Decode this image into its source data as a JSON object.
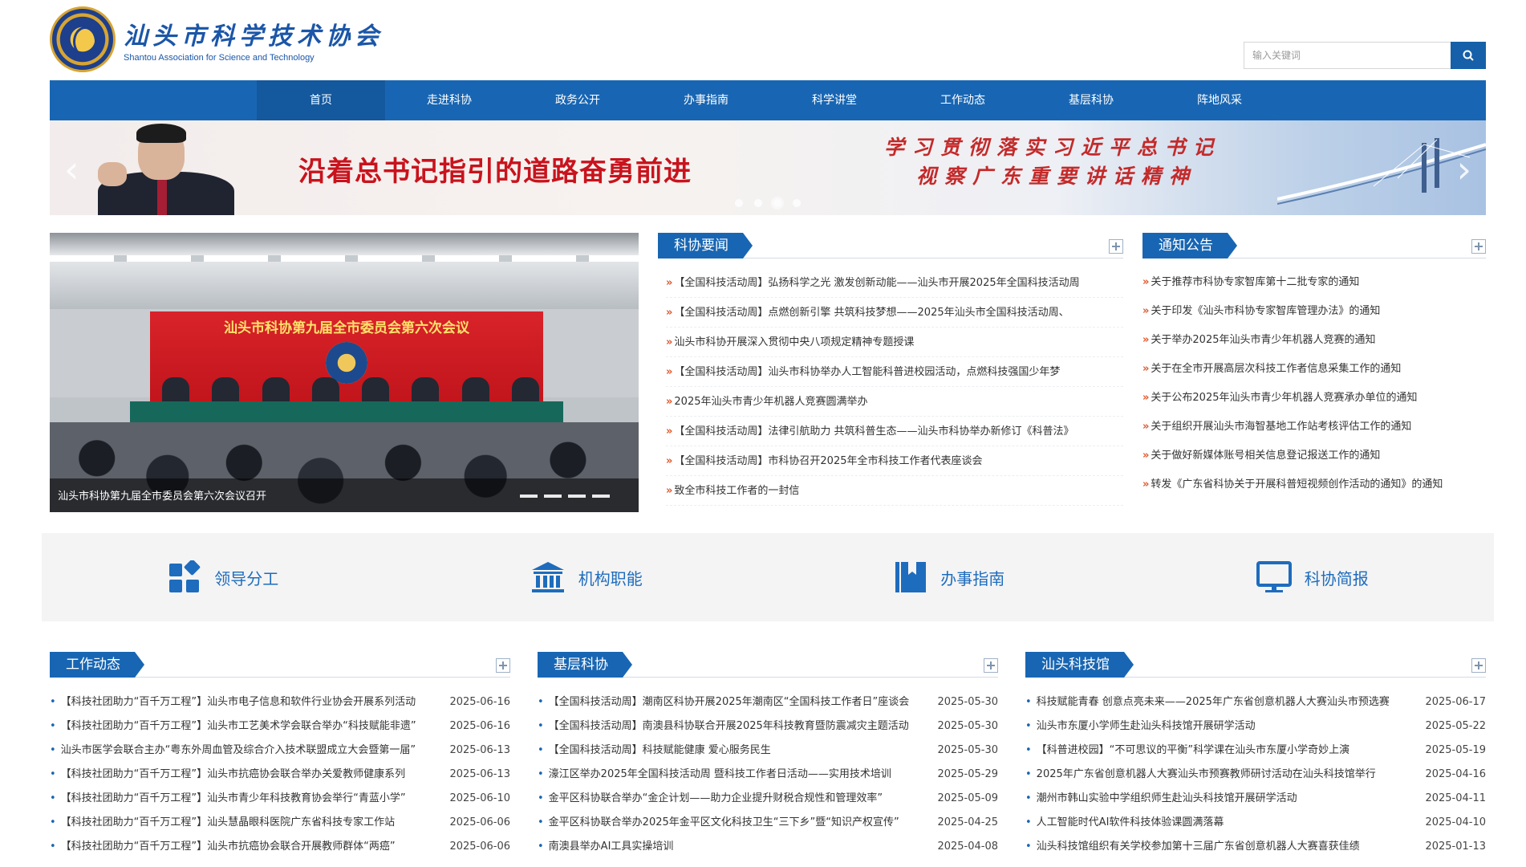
{
  "header": {
    "logo_cn": "汕头市科学技术协会",
    "logo_en": "Shantou Association for Science and Technology",
    "search_placeholder": "输入关键词"
  },
  "nav": [
    "首页",
    "走进科协",
    "政务公开",
    "办事指南",
    "科学讲堂",
    "工作动态",
    "基层科协",
    "阵地风采"
  ],
  "banner": {
    "title": "沿着总书记指引的道路奋勇前进",
    "sub_line1": "学习贯彻落实习近平总书记",
    "sub_line2": "视察广东重要讲话精神"
  },
  "photo": {
    "screen_text": "汕头市科协第九届全市委员会第六次会议",
    "caption": "汕头市科协第九届全市委员会第六次会议召开"
  },
  "news": {
    "title": "科协要闻",
    "items": [
      "【全国科技活动周】弘扬科学之光 激发创新动能——汕头市开展2025年全国科技活动周",
      "【全国科技活动周】点燃创新引擎 共筑科技梦想——2025年汕头市全国科技活动周、",
      "汕头市科协开展深入贯彻中央八项规定精神专题授课",
      "【全国科技活动周】汕头市科协举办人工智能科普进校园活动，点燃科技强国少年梦",
      "2025年汕头市青少年机器人竞赛圆满举办",
      "【全国科技活动周】法律引航助力 共筑科普生态——汕头市科协举办新修订《科普法》",
      "【全国科技活动周】市科协召开2025年全市科技工作者代表座谈会",
      "致全市科技工作者的一封信"
    ]
  },
  "notice": {
    "title": "通知公告",
    "items": [
      "关于推荐市科协专家智库第十二批专家的通知",
      "关于印发《汕头市科协专家智库管理办法》的通知",
      "关于举办2025年汕头市青少年机器人竞赛的通知",
      "关于在全市开展高层次科技工作者信息采集工作的通知",
      "关于公布2025年汕头市青少年机器人竞赛承办单位的通知",
      "关于组织开展汕头市海智基地工作站考核评估工作的通知",
      "关于做好新媒体账号相关信息登记报送工作的通知",
      "转发《广东省科协关于开展科普短视频创作活动的通知》的通知"
    ]
  },
  "quick_links": [
    {
      "label": "领导分工",
      "icon": "leadership-icon"
    },
    {
      "label": "机构职能",
      "icon": "institution-icon"
    },
    {
      "label": "办事指南",
      "icon": "guide-book-icon"
    },
    {
      "label": "科协简报",
      "icon": "monitor-icon"
    }
  ],
  "work": {
    "title": "工作动态",
    "items": [
      {
        "t": "【科技社团助力“百千万工程”】汕头市电子信息和软件行业协会开展系列活动",
        "d": "2025-06-16"
      },
      {
        "t": "【科技社团助力“百千万工程”】汕头市工艺美术学会联合举办“科技赋能非遗”",
        "d": "2025-06-16"
      },
      {
        "t": "汕头市医学会联合主办“粤东外周血管及综合介入技术联盟成立大会暨第一届”",
        "d": "2025-06-13"
      },
      {
        "t": "【科技社团助力“百千万工程”】汕头市抗癌协会联合举办关爱教师健康系列",
        "d": "2025-06-13"
      },
      {
        "t": "【科技社团助力“百千万工程”】汕头市青少年科技教育协会举行“青蓝小学”",
        "d": "2025-06-10"
      },
      {
        "t": "【科技社团助力“百千万工程”】汕头慧晶眼科医院广东省科技专家工作站",
        "d": "2025-06-06"
      },
      {
        "t": "【科技社团助力“百千万工程”】汕头市抗癌协会联合开展教师群体“两癌”",
        "d": "2025-06-06"
      }
    ]
  },
  "grassroots": {
    "title": "基层科协",
    "items": [
      {
        "t": "【全国科技活动周】潮南区科协开展2025年潮南区“全国科技工作者日”座谈会",
        "d": "2025-05-30"
      },
      {
        "t": "【全国科技活动周】南澳县科协联合开展2025年科技教育暨防震减灾主题活动",
        "d": "2025-05-30"
      },
      {
        "t": "【全国科技活动周】科技赋能健康 爱心服务民生",
        "d": "2025-05-30"
      },
      {
        "t": "濠江区举办2025年全国科技活动周 暨科技工作者日活动——实用技术培训",
        "d": "2025-05-29"
      },
      {
        "t": "金平区科协联合举办“金企计划——助力企业提升财税合规性和管理效率”",
        "d": "2025-05-09"
      },
      {
        "t": "金平区科协联合举办2025年金平区文化科技卫生“三下乡”暨“知识产权宣传”",
        "d": "2025-04-25"
      },
      {
        "t": "南澳县举办AI工具实操培训",
        "d": "2025-04-08"
      }
    ]
  },
  "museum": {
    "title": "汕头科技馆",
    "items": [
      {
        "t": "科技赋能青春 创意点亮未来——2025年广东省创意机器人大赛汕头市预选赛",
        "d": "2025-06-17"
      },
      {
        "t": "汕头市东厦小学师生赴汕头科技馆开展研学活动",
        "d": "2025-05-22"
      },
      {
        "t": "【科普进校园】“不可思议的平衡”科学课在汕头市东厦小学奇妙上演",
        "d": "2025-05-19"
      },
      {
        "t": "2025年广东省创意机器人大赛汕头市预赛教师研讨活动在汕头科技馆举行",
        "d": "2025-04-16"
      },
      {
        "t": "潮州市韩山实验中学组织师生赴汕头科技馆开展研学活动",
        "d": "2025-04-11"
      },
      {
        "t": "人工智能时代AI软件科技体验课圆满落幕",
        "d": "2025-04-10"
      },
      {
        "t": "汕头科技馆组织有关学校参加第十三届广东省创意机器人大赛喜获佳绩",
        "d": "2025-01-13"
      }
    ]
  }
}
